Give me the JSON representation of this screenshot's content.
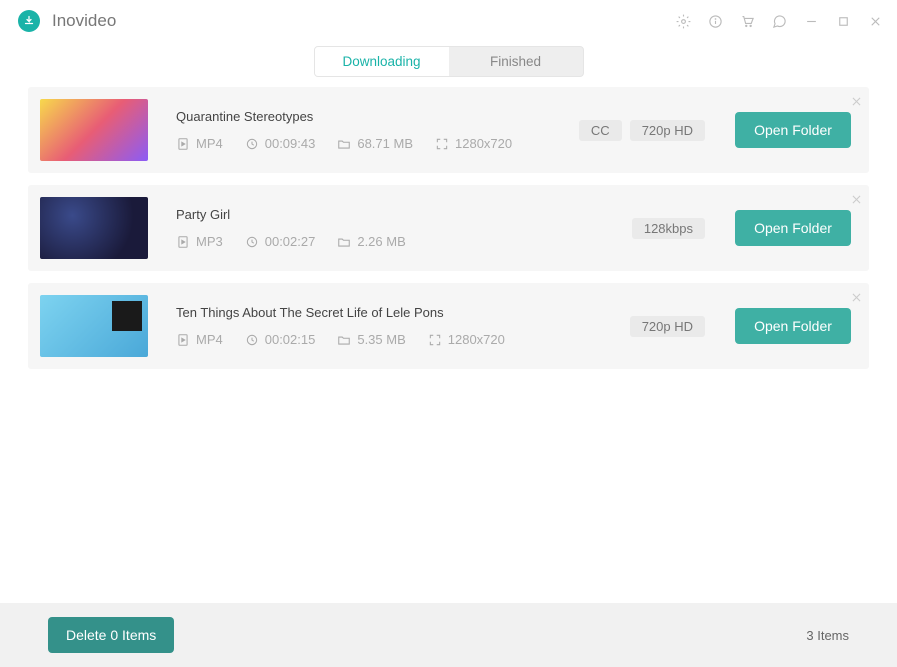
{
  "app": {
    "name": "Inovideo"
  },
  "tabs": {
    "downloading": "Downloading",
    "finished": "Finished"
  },
  "items": [
    {
      "title": "Quarantine Stereotypes",
      "format": "MP4",
      "duration": "00:09:43",
      "size": "68.71 MB",
      "resolution": "1280x720",
      "cc": "CC",
      "quality": "720p HD",
      "open_label": "Open Folder"
    },
    {
      "title": "Party Girl",
      "format": "MP3",
      "duration": "00:02:27",
      "size": "2.26 MB",
      "resolution": "",
      "cc": "",
      "quality": "128kbps",
      "open_label": "Open Folder"
    },
    {
      "title": "Ten Things About The Secret Life of Lele Pons",
      "format": "MP4",
      "duration": "00:02:15",
      "size": "5.35 MB",
      "resolution": "1280x720",
      "cc": "",
      "quality": "720p HD",
      "open_label": "Open Folder"
    }
  ],
  "footer": {
    "delete_label": "Delete 0 Items",
    "count_label": "3 Items"
  }
}
